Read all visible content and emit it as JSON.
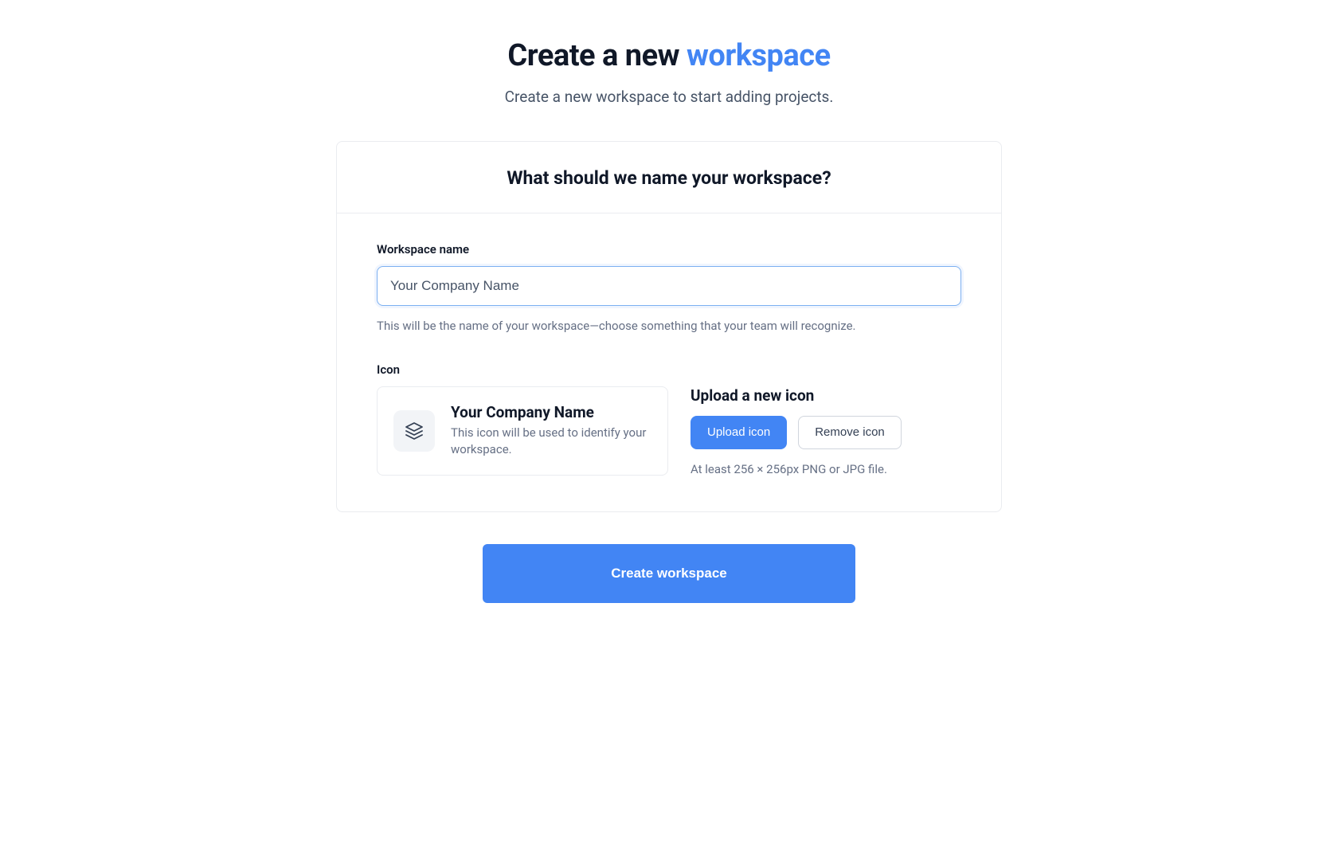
{
  "header": {
    "title_prefix": "Create a new ",
    "title_accent": "workspace",
    "subtitle": "Create a new workspace to start adding projects."
  },
  "card": {
    "header_title": "What should we name your workspace?",
    "workspace_name": {
      "label": "Workspace name",
      "value": "Your Company Name",
      "placeholder": "Your Company Name",
      "help": "This will be the name of your workspace—choose something that your team will recognize."
    },
    "icon": {
      "label": "Icon",
      "preview_title": "Your Company Name",
      "preview_desc": "This icon will be used to identify your workspace.",
      "icon_name": "layers-icon",
      "upload_title": "Upload a new icon",
      "upload_button": "Upload icon",
      "remove_button": "Remove icon",
      "hint": "At least 256 × 256px PNG or JPG file."
    }
  },
  "actions": {
    "submit_label": "Create workspace"
  },
  "colors": {
    "accent": "#4285f4",
    "text_primary": "#101828",
    "text_secondary": "#667085",
    "border": "#eaecf0"
  }
}
